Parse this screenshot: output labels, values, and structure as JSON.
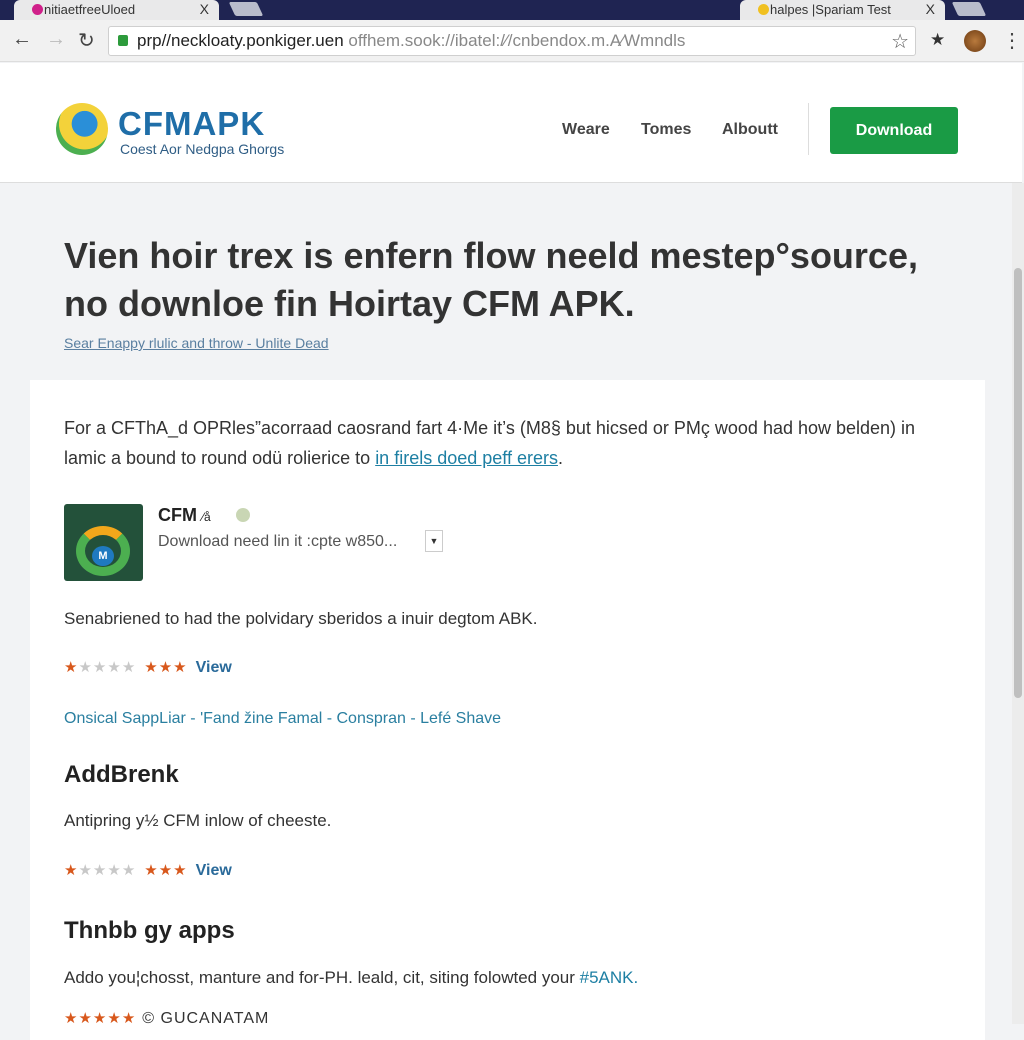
{
  "browser": {
    "tabs": [
      {
        "title": "nitiaetfreeUloed",
        "favicon_color": "#d0208a"
      },
      {
        "title": "halpes |Spariam Test",
        "favicon_color": "#f0c020"
      }
    ],
    "tab_close": "X",
    "url_host": "prp//neckloaty.ponkiger.uen",
    "url_path": " offhem.sook://ibatel:/⁄/cnbendox.m.A⁄Wmndls"
  },
  "header": {
    "logo_title": "CFMAPK",
    "logo_subtitle": "Coest Aor Nedgpa Ghorgs",
    "nav": [
      "Weare",
      "Tomes",
      "Alboutt"
    ],
    "download_label": "Download",
    "accent": "#1a9b45"
  },
  "hero": {
    "title": "Vien hoir trex is enfern flow neeld mestep°source, no downloe fin Hoirtay CFM APK.",
    "subtitle": "Sear Enappy rlulic and throw - Unlite Dead"
  },
  "content": {
    "intro_text": "For a CFThA_d OPRles”acorraad caosrand fart 4·Me it’s (M8§ but hicsed or PMç wood had how belden) in lamic a bound to round odü rolierice to ",
    "intro_link": "in firels doed peff erers",
    "intro_end": ".",
    "app": {
      "name": "CFM",
      "name_suffix": "⁄å",
      "description": "Download need lin it :cpte w850...",
      "icon_letter": "M"
    },
    "paragraph1": "Senabriened to had the polvidary sberidos a inuir degtom ABK.",
    "rating1": {
      "stars": [
        "on",
        "off",
        "off",
        "off",
        "off",
        "on",
        "on",
        "on"
      ],
      "view": "View"
    },
    "tags": "Onsical SappLiar - 'Fand žine Famal - Conspran - Lefé Shave",
    "section1_title": "AddBrenk",
    "section1_text": "Antipring y½ CFM inlow of cheeste.",
    "rating2": {
      "stars": [
        "on",
        "off",
        "off",
        "off",
        "off",
        "on",
        "on",
        "on"
      ],
      "view": "View"
    },
    "section2_title": "Thnbb gy apps",
    "section2_text": "Addo you¦chosst, manture and for-PH. leald, cit, siting folowted your ",
    "section2_link": "#5ANK.",
    "rating3": {
      "stars": [
        "on",
        "on",
        "on",
        "on",
        "on"
      ],
      "label": "© GUCANATAM"
    }
  }
}
